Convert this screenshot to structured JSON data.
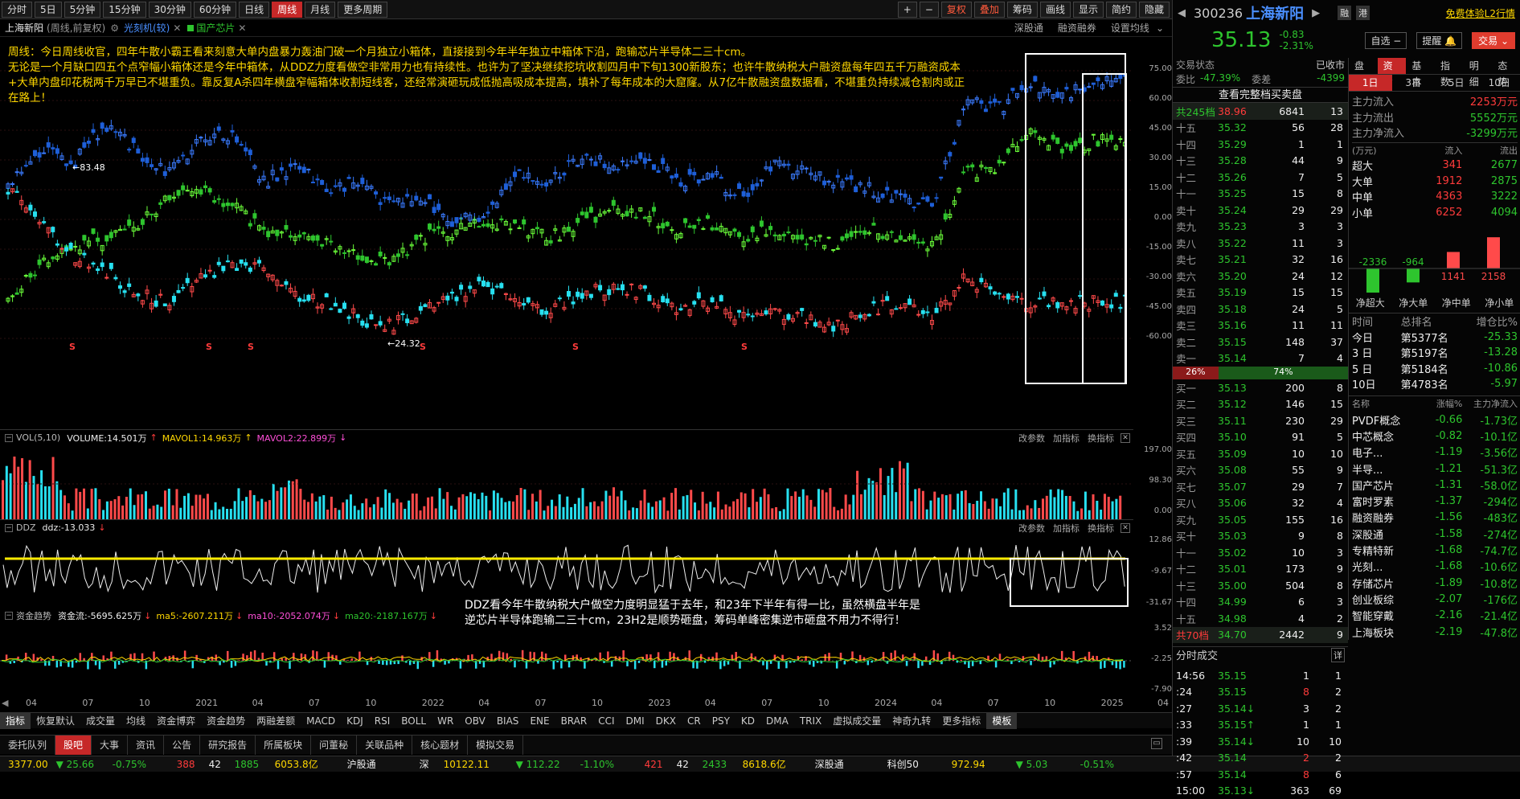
{
  "toolbar": {
    "periods": [
      "分时",
      "5日",
      "5分钟",
      "15分钟",
      "30分钟",
      "60分钟",
      "日线",
      "周线",
      "月线",
      "更多周期"
    ],
    "right": [
      "+",
      "−",
      "复权",
      "叠加",
      "筹码",
      "画线",
      "显示",
      "简约",
      "隐藏"
    ]
  },
  "title": {
    "name": "上海新阳",
    "mode": "(周线,前复权)",
    "overlay1": "光刻机(较)",
    "overlay2": "国产芯片",
    "links": [
      "深股通",
      "融资融券",
      "设置均线"
    ]
  },
  "annotation_main": "周线：今日周线收官，四年牛散小霸王看来刻意大单内盘暴力轰油门破一个月独立小箱体，直接接到今年半年独立中箱体下沿，跑输芯片半导体二三十cm。\n无论是一个月缺口四五个点窄幅小箱体还是今年中箱体，从DDZ力度看做空非常用力也有持续性。也许为了坚决继续挖坑收割四月中下旬1300新股东；也许牛散纳税大户融资盘每年四五千万融资成本+大单内盘印花税两千万早已不堪重负。靠反复A杀四年横盘窄幅箱体收割短线客，还经常演砸玩成低抛高吸成本提高，填补了每年成本的大窟窿。从7亿牛散融资盘数据看，不堪重负持续减仓割肉或正在路上！",
  "annotation_ddz": "DDZ看今年牛散纳税大户做空力度明显猛于去年，和23年下半年有得一比，虽然横盘半年是\n逆芯片半导体跑输二三十cm，23H2是顺势砸盘，筹码单峰密集逆市砸盘不用力不得行！",
  "price_axis": [
    "75.00",
    "60.00",
    "45.00",
    "30.00",
    "15.00",
    "0.00",
    "-15.00",
    "-30.00",
    "-45.00",
    "-60.00"
  ],
  "marks": {
    "high": "83.48",
    "low": "24.32"
  },
  "vol": {
    "label": "VOL(5,10)",
    "volume": "VOLUME:14.501万",
    "ma1": "MAVOL1:14.963万",
    "ma2": "MAVOL2:22.899万",
    "axis": [
      "197.00",
      "98.30",
      "0.00"
    ]
  },
  "ddz": {
    "label": "DDZ",
    "value": "ddz:-13.033",
    "axis": [
      "12.86",
      "-9.67",
      "-31.67"
    ]
  },
  "fund": {
    "label": "资金趋势",
    "flow": "资金流:-5695.625万",
    "ma5": "ma5:-2607.211万",
    "ma10": "ma10:-2052.074万",
    "ma20": "ma20:-2187.167万",
    "axis": [
      "3.52",
      "-2.25",
      "-7.90"
    ]
  },
  "panel_actions": [
    "改参数",
    "加指标",
    "换指标"
  ],
  "x_axis": [
    "04",
    "07",
    "10",
    "2021",
    "04",
    "07",
    "10",
    "2022",
    "04",
    "07",
    "10",
    "2023",
    "04",
    "07",
    "10",
    "2024",
    "04",
    "07",
    "10",
    "2025",
    "04"
  ],
  "indicator_tabs": [
    "指标",
    "恢复默认",
    "成交量",
    "均线",
    "资金博弈",
    "资金趋势",
    "两融差额",
    "MACD",
    "KDJ",
    "RSI",
    "BOLL",
    "WR",
    "OBV",
    "BIAS",
    "ENE",
    "BRAR",
    "CCI",
    "DMI",
    "DKX",
    "CR",
    "PSY",
    "KD",
    "DMA",
    "TRIX",
    "虚拟成交量",
    "神奇九转",
    "更多指标",
    "模板"
  ],
  "bottom_tabs": [
    "委托队列",
    "股吧",
    "大事",
    "资讯",
    "公告",
    "研究报告",
    "所属板块",
    "问董秘",
    "关联品种",
    "核心题材",
    "模拟交易"
  ],
  "status": {
    "sh": "3377.00",
    "sh_chg": "▼ 25.66",
    "sh_pct": "-0.75%",
    "sh_up": "388",
    "sh_flat": "42",
    "sh_down": "1885",
    "sh_amt": "6053.8亿",
    "hgt": "沪股通",
    "sz_lbl": "深",
    "sz": "10122.11",
    "sz_chg": "▼ 112.22",
    "sz_pct": "-1.10%",
    "sz_up": "421",
    "sz_flat": "42",
    "sz_down": "2433",
    "sz_amt": "8618.6亿",
    "sgt": "深股通",
    "kc_lbl": "科创50",
    "kc": "972.94",
    "kc_chg": "▼ 5.03",
    "kc_pct": "-0.51%"
  },
  "right": {
    "code": "300236",
    "name": "上海新阳",
    "tags": [
      "融",
      "港"
    ],
    "l2": "免费体验L2行情",
    "price": "35.13",
    "chg": "-0.83",
    "pct": "-2.31%",
    "self": "自选",
    "remind": "提醒",
    "trade": "交易",
    "state_lbl": "交易状态",
    "state": "已收市",
    "wb_lbl": "委比",
    "wb": "-47.39%",
    "wc_lbl": "委差",
    "wc": "-4399",
    "full": "查看完整档买卖盘",
    "ask_total": {
      "label": "共245档",
      "price": "38.96",
      "vol": "6841",
      "cnt": "13"
    },
    "asks": [
      [
        "十五",
        "35.32",
        "56",
        "28"
      ],
      [
        "十四",
        "35.29",
        "1",
        "1"
      ],
      [
        "十三",
        "35.28",
        "44",
        "9"
      ],
      [
        "十二",
        "35.26",
        "7",
        "5"
      ],
      [
        "十一",
        "35.25",
        "15",
        "8"
      ],
      [
        "卖十",
        "35.24",
        "29",
        "29"
      ],
      [
        "卖九",
        "35.23",
        "3",
        "3"
      ],
      [
        "卖八",
        "35.22",
        "11",
        "3"
      ],
      [
        "卖七",
        "35.21",
        "32",
        "16"
      ],
      [
        "卖六",
        "35.20",
        "24",
        "12"
      ],
      [
        "卖五",
        "35.19",
        "15",
        "15"
      ],
      [
        "卖四",
        "35.18",
        "24",
        "5"
      ],
      [
        "卖三",
        "35.16",
        "11",
        "11"
      ],
      [
        "卖二",
        "35.15",
        "148",
        "37"
      ],
      [
        "卖一",
        "35.14",
        "7",
        "4"
      ]
    ],
    "ratio": [
      "26%",
      "74%"
    ],
    "bids": [
      [
        "买一",
        "35.13",
        "200",
        "8"
      ],
      [
        "买二",
        "35.12",
        "146",
        "15"
      ],
      [
        "买三",
        "35.11",
        "230",
        "29"
      ],
      [
        "买四",
        "35.10",
        "91",
        "5"
      ],
      [
        "买五",
        "35.09",
        "10",
        "10"
      ],
      [
        "买六",
        "35.08",
        "55",
        "9"
      ],
      [
        "买七",
        "35.07",
        "29",
        "7"
      ],
      [
        "买八",
        "35.06",
        "32",
        "4"
      ],
      [
        "买九",
        "35.05",
        "155",
        "16"
      ],
      [
        "买十",
        "35.03",
        "9",
        "8"
      ],
      [
        "十一",
        "35.02",
        "10",
        "3"
      ],
      [
        "十二",
        "35.01",
        "173",
        "9"
      ],
      [
        "十三",
        "35.00",
        "504",
        "8"
      ],
      [
        "十四",
        "34.99",
        "6",
        "3"
      ],
      [
        "十五",
        "34.98",
        "4",
        "2"
      ]
    ],
    "bid_total": {
      "label": "共70档",
      "price": "34.70",
      "vol": "2442",
      "cnt": "9"
    },
    "fen_lbl": "分时成交",
    "fen_more": "详",
    "trades": [
      [
        "14:56",
        "35.15",
        "1",
        "1"
      ],
      [
        ":24",
        "35.15",
        "8",
        "2"
      ],
      [
        ":27",
        "35.14↓",
        "3",
        "2"
      ],
      [
        ":33",
        "35.15↑",
        "1",
        "1"
      ],
      [
        ":39",
        "35.14↓",
        "10",
        "10"
      ],
      [
        ":42",
        "35.14",
        "2",
        "2"
      ],
      [
        ":57",
        "35.14",
        "8",
        "6"
      ],
      [
        "15:00",
        "35.13↓",
        "363",
        "69"
      ]
    ],
    "ftabs": [
      "盘口",
      "资金",
      "基本",
      "指数",
      "明细",
      "态势"
    ],
    "days": [
      "1日",
      "3日",
      "5日",
      "10日"
    ],
    "main": [
      [
        "主力流入",
        "2253万元"
      ],
      [
        "主力流出",
        "5552万元"
      ],
      [
        "主力净流入",
        "-3299万元"
      ]
    ],
    "flow_hdr": [
      "(万元)",
      "流入",
      "流出"
    ],
    "flows": [
      [
        "超大",
        "341",
        "2677"
      ],
      [
        "大单",
        "1912",
        "2875"
      ],
      [
        "中单",
        "4363",
        "3222"
      ],
      [
        "小单",
        "6252",
        "4094"
      ]
    ],
    "net_vals": [
      "-2336",
      "-964",
      "1141",
      "2158"
    ],
    "net_lbls": [
      "净超大",
      "净大单",
      "净中单",
      "净小单"
    ],
    "rank_hdr": [
      "时间",
      "总排名",
      "增仓比%"
    ],
    "ranks": [
      [
        "今日",
        "第5377名",
        "-25.33"
      ],
      [
        "3 日",
        "第5197名",
        "-13.28"
      ],
      [
        "5 日",
        "第5184名",
        "-10.86"
      ],
      [
        "10日",
        "第4783名",
        "-5.97"
      ]
    ],
    "sec_hdr": [
      "名称",
      "涨幅%",
      "主力净流入"
    ],
    "sectors": [
      [
        "PVDF概念",
        "-0.66",
        "-1.73亿"
      ],
      [
        "中芯概念",
        "-0.82",
        "-10.1亿"
      ],
      [
        "电子...",
        "-1.19",
        "-3.56亿"
      ],
      [
        "半导...",
        "-1.21",
        "-51.3亿"
      ],
      [
        "国产芯片",
        "-1.31",
        "-58.0亿"
      ],
      [
        "富时罗素",
        "-1.37",
        "-294亿"
      ],
      [
        "融资融券",
        "-1.56",
        "-483亿"
      ],
      [
        "深股通",
        "-1.58",
        "-274亿"
      ],
      [
        "专精特新",
        "-1.68",
        "-74.7亿"
      ],
      [
        "光刻...",
        "-1.68",
        "-10.6亿"
      ],
      [
        "存储芯片",
        "-1.89",
        "-10.8亿"
      ],
      [
        "创业板综",
        "-2.07",
        "-176亿"
      ],
      [
        "智能穿戴",
        "-2.16",
        "-21.4亿"
      ],
      [
        "上海板块",
        "-2.19",
        "-47.8亿"
      ]
    ]
  }
}
